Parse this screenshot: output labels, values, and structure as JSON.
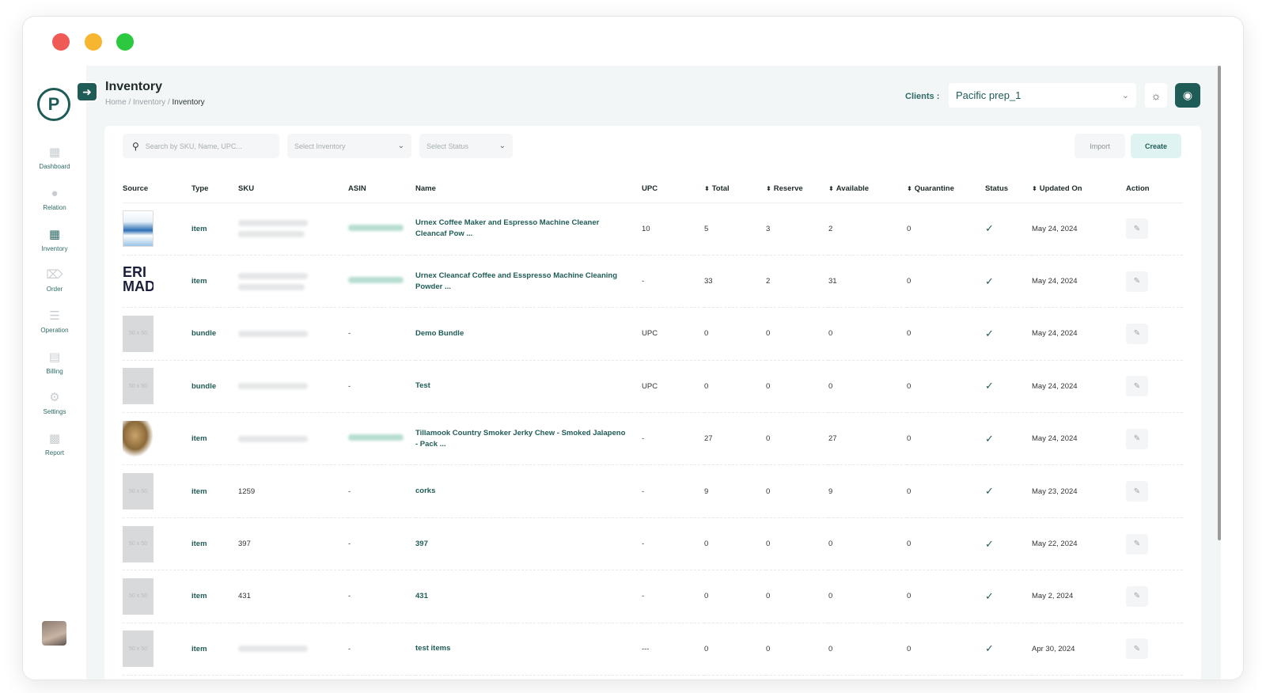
{
  "sidebar": {
    "logo_letter": "P",
    "items": [
      {
        "label": "Dashboard",
        "icon": "grid-icon"
      },
      {
        "label": "Relation",
        "icon": "users-icon"
      },
      {
        "label": "Inventory",
        "icon": "inventory-icon"
      },
      {
        "label": "Order",
        "icon": "cart-icon"
      },
      {
        "label": "Operation",
        "icon": "layers-icon"
      },
      {
        "label": "Billing",
        "icon": "document-icon"
      },
      {
        "label": "Settings",
        "icon": "gear-icon"
      },
      {
        "label": "Report",
        "icon": "bar-chart-icon"
      }
    ],
    "active": "Inventory"
  },
  "header": {
    "title": "Inventory",
    "breadcrumb": [
      "Home",
      "Inventory",
      "Inventory"
    ],
    "clients_label": "Clients :",
    "client_value": "Pacific prep_1"
  },
  "toolbar": {
    "search_placeholder": "Search by SKU, Name, UPC...",
    "inventory_placeholder": "Select Inventory",
    "status_placeholder": "Select Status",
    "import_label": "Import",
    "create_label": "Create"
  },
  "table": {
    "columns": [
      "Source",
      "Type",
      "SKU",
      "ASIN",
      "Name",
      "UPC",
      "Total",
      "Reserve",
      "Available",
      "Quarantine",
      "Status",
      "Updated On",
      "Action"
    ],
    "sortable": [
      "Total",
      "Reserve",
      "Available",
      "Quarantine",
      "Updated On"
    ],
    "placeholder_text": "50 x 50",
    "rows": [
      {
        "type": "item",
        "sku": "",
        "asin": "",
        "name": "Urnex Coffee Maker and Espresso Machine Cleaner Cleancaf Pow ...",
        "upc": "10",
        "total": "5",
        "reserve": "3",
        "available": "2",
        "quarantine": "0",
        "updated": "May 24, 2024"
      },
      {
        "type": "item",
        "sku": "",
        "asin": "",
        "name": "Urnex Cleancaf Coffee and Esspresso Machine Cleaning Powder ...",
        "upc": "-",
        "total": "33",
        "reserve": "2",
        "available": "31",
        "quarantine": "0",
        "updated": "May 24, 2024"
      },
      {
        "type": "bundle",
        "sku": "",
        "asin": "-",
        "name": "Demo Bundle",
        "upc": "UPC",
        "total": "0",
        "reserve": "0",
        "available": "0",
        "quarantine": "0",
        "updated": "May 24, 2024"
      },
      {
        "type": "bundle",
        "sku": "",
        "asin": "-",
        "name": "Test",
        "upc": "UPC",
        "total": "0",
        "reserve": "0",
        "available": "0",
        "quarantine": "0",
        "updated": "May 24, 2024"
      },
      {
        "type": "item",
        "sku": "",
        "asin": "",
        "name": "Tillamook Country Smoker Jerky Chew - Smoked Jalapeno - Pack ...",
        "upc": "-",
        "total": "27",
        "reserve": "0",
        "available": "27",
        "quarantine": "0",
        "updated": "May 24, 2024"
      },
      {
        "type": "item",
        "sku": "1259",
        "asin": "-",
        "name": "corks",
        "upc": "-",
        "total": "9",
        "reserve": "0",
        "available": "9",
        "quarantine": "0",
        "updated": "May 23, 2024"
      },
      {
        "type": "item",
        "sku": "397",
        "asin": "-",
        "name": "397",
        "upc": "-",
        "total": "0",
        "reserve": "0",
        "available": "0",
        "quarantine": "0",
        "updated": "May 22, 2024"
      },
      {
        "type": "item",
        "sku": "431",
        "asin": "-",
        "name": "431",
        "upc": "-",
        "total": "0",
        "reserve": "0",
        "available": "0",
        "quarantine": "0",
        "updated": "May 2, 2024"
      },
      {
        "type": "item",
        "sku": "",
        "asin": "-",
        "name": "test items",
        "upc": "---",
        "total": "0",
        "reserve": "0",
        "available": "0",
        "quarantine": "0",
        "updated": "Apr 30, 2024"
      }
    ]
  },
  "colors": {
    "accent": "#1f5c57",
    "background": "#f3f6f7",
    "create_bg": "#dff4f2"
  }
}
